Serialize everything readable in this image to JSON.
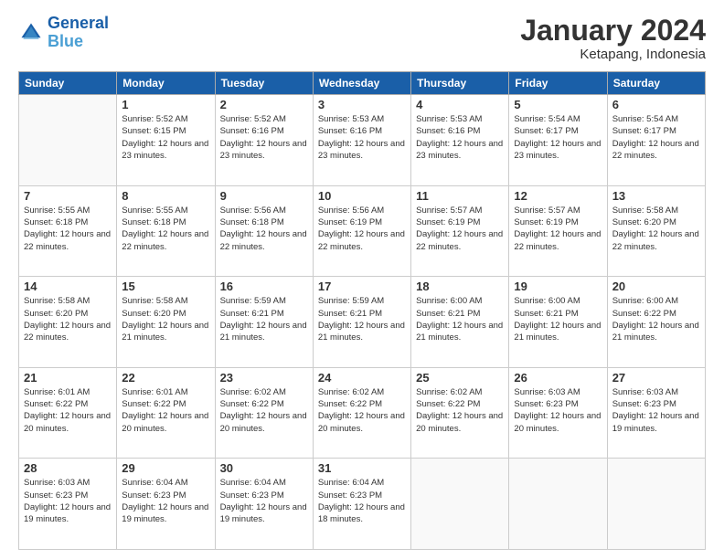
{
  "header": {
    "logo_line1": "General",
    "logo_line2": "Blue",
    "month": "January 2024",
    "location": "Ketapang, Indonesia"
  },
  "weekdays": [
    "Sunday",
    "Monday",
    "Tuesday",
    "Wednesday",
    "Thursday",
    "Friday",
    "Saturday"
  ],
  "weeks": [
    [
      {
        "day": "",
        "sunrise": "",
        "sunset": "",
        "daylight": ""
      },
      {
        "day": "1",
        "sunrise": "Sunrise: 5:52 AM",
        "sunset": "Sunset: 6:15 PM",
        "daylight": "Daylight: 12 hours and 23 minutes."
      },
      {
        "day": "2",
        "sunrise": "Sunrise: 5:52 AM",
        "sunset": "Sunset: 6:16 PM",
        "daylight": "Daylight: 12 hours and 23 minutes."
      },
      {
        "day": "3",
        "sunrise": "Sunrise: 5:53 AM",
        "sunset": "Sunset: 6:16 PM",
        "daylight": "Daylight: 12 hours and 23 minutes."
      },
      {
        "day": "4",
        "sunrise": "Sunrise: 5:53 AM",
        "sunset": "Sunset: 6:16 PM",
        "daylight": "Daylight: 12 hours and 23 minutes."
      },
      {
        "day": "5",
        "sunrise": "Sunrise: 5:54 AM",
        "sunset": "Sunset: 6:17 PM",
        "daylight": "Daylight: 12 hours and 23 minutes."
      },
      {
        "day": "6",
        "sunrise": "Sunrise: 5:54 AM",
        "sunset": "Sunset: 6:17 PM",
        "daylight": "Daylight: 12 hours and 22 minutes."
      }
    ],
    [
      {
        "day": "7",
        "sunrise": "Sunrise: 5:55 AM",
        "sunset": "Sunset: 6:18 PM",
        "daylight": "Daylight: 12 hours and 22 minutes."
      },
      {
        "day": "8",
        "sunrise": "Sunrise: 5:55 AM",
        "sunset": "Sunset: 6:18 PM",
        "daylight": "Daylight: 12 hours and 22 minutes."
      },
      {
        "day": "9",
        "sunrise": "Sunrise: 5:56 AM",
        "sunset": "Sunset: 6:18 PM",
        "daylight": "Daylight: 12 hours and 22 minutes."
      },
      {
        "day": "10",
        "sunrise": "Sunrise: 5:56 AM",
        "sunset": "Sunset: 6:19 PM",
        "daylight": "Daylight: 12 hours and 22 minutes."
      },
      {
        "day": "11",
        "sunrise": "Sunrise: 5:57 AM",
        "sunset": "Sunset: 6:19 PM",
        "daylight": "Daylight: 12 hours and 22 minutes."
      },
      {
        "day": "12",
        "sunrise": "Sunrise: 5:57 AM",
        "sunset": "Sunset: 6:19 PM",
        "daylight": "Daylight: 12 hours and 22 minutes."
      },
      {
        "day": "13",
        "sunrise": "Sunrise: 5:58 AM",
        "sunset": "Sunset: 6:20 PM",
        "daylight": "Daylight: 12 hours and 22 minutes."
      }
    ],
    [
      {
        "day": "14",
        "sunrise": "Sunrise: 5:58 AM",
        "sunset": "Sunset: 6:20 PM",
        "daylight": "Daylight: 12 hours and 22 minutes."
      },
      {
        "day": "15",
        "sunrise": "Sunrise: 5:58 AM",
        "sunset": "Sunset: 6:20 PM",
        "daylight": "Daylight: 12 hours and 21 minutes."
      },
      {
        "day": "16",
        "sunrise": "Sunrise: 5:59 AM",
        "sunset": "Sunset: 6:21 PM",
        "daylight": "Daylight: 12 hours and 21 minutes."
      },
      {
        "day": "17",
        "sunrise": "Sunrise: 5:59 AM",
        "sunset": "Sunset: 6:21 PM",
        "daylight": "Daylight: 12 hours and 21 minutes."
      },
      {
        "day": "18",
        "sunrise": "Sunrise: 6:00 AM",
        "sunset": "Sunset: 6:21 PM",
        "daylight": "Daylight: 12 hours and 21 minutes."
      },
      {
        "day": "19",
        "sunrise": "Sunrise: 6:00 AM",
        "sunset": "Sunset: 6:21 PM",
        "daylight": "Daylight: 12 hours and 21 minutes."
      },
      {
        "day": "20",
        "sunrise": "Sunrise: 6:00 AM",
        "sunset": "Sunset: 6:22 PM",
        "daylight": "Daylight: 12 hours and 21 minutes."
      }
    ],
    [
      {
        "day": "21",
        "sunrise": "Sunrise: 6:01 AM",
        "sunset": "Sunset: 6:22 PM",
        "daylight": "Daylight: 12 hours and 20 minutes."
      },
      {
        "day": "22",
        "sunrise": "Sunrise: 6:01 AM",
        "sunset": "Sunset: 6:22 PM",
        "daylight": "Daylight: 12 hours and 20 minutes."
      },
      {
        "day": "23",
        "sunrise": "Sunrise: 6:02 AM",
        "sunset": "Sunset: 6:22 PM",
        "daylight": "Daylight: 12 hours and 20 minutes."
      },
      {
        "day": "24",
        "sunrise": "Sunrise: 6:02 AM",
        "sunset": "Sunset: 6:22 PM",
        "daylight": "Daylight: 12 hours and 20 minutes."
      },
      {
        "day": "25",
        "sunrise": "Sunrise: 6:02 AM",
        "sunset": "Sunset: 6:22 PM",
        "daylight": "Daylight: 12 hours and 20 minutes."
      },
      {
        "day": "26",
        "sunrise": "Sunrise: 6:03 AM",
        "sunset": "Sunset: 6:23 PM",
        "daylight": "Daylight: 12 hours and 20 minutes."
      },
      {
        "day": "27",
        "sunrise": "Sunrise: 6:03 AM",
        "sunset": "Sunset: 6:23 PM",
        "daylight": "Daylight: 12 hours and 19 minutes."
      }
    ],
    [
      {
        "day": "28",
        "sunrise": "Sunrise: 6:03 AM",
        "sunset": "Sunset: 6:23 PM",
        "daylight": "Daylight: 12 hours and 19 minutes."
      },
      {
        "day": "29",
        "sunrise": "Sunrise: 6:04 AM",
        "sunset": "Sunset: 6:23 PM",
        "daylight": "Daylight: 12 hours and 19 minutes."
      },
      {
        "day": "30",
        "sunrise": "Sunrise: 6:04 AM",
        "sunset": "Sunset: 6:23 PM",
        "daylight": "Daylight: 12 hours and 19 minutes."
      },
      {
        "day": "31",
        "sunrise": "Sunrise: 6:04 AM",
        "sunset": "Sunset: 6:23 PM",
        "daylight": "Daylight: 12 hours and 18 minutes."
      },
      {
        "day": "",
        "sunrise": "",
        "sunset": "",
        "daylight": ""
      },
      {
        "day": "",
        "sunrise": "",
        "sunset": "",
        "daylight": ""
      },
      {
        "day": "",
        "sunrise": "",
        "sunset": "",
        "daylight": ""
      }
    ]
  ]
}
